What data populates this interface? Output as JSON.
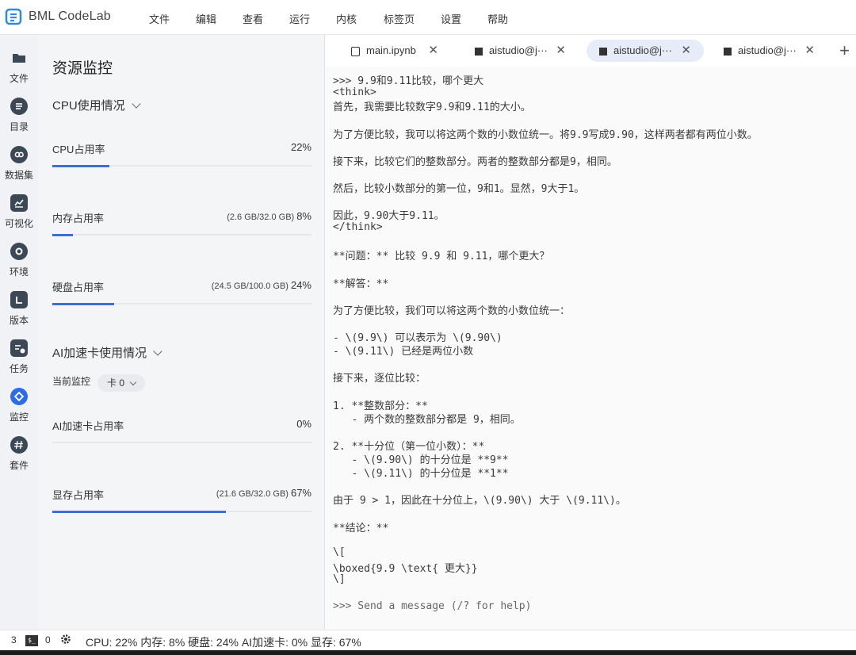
{
  "app": {
    "name": "BML CodeLab"
  },
  "menu": [
    "文件",
    "编辑",
    "查看",
    "运行",
    "内核",
    "标签页",
    "设置",
    "帮助"
  ],
  "sidebar": [
    {
      "label": "文件",
      "icon": "folder-icon"
    },
    {
      "label": "目录",
      "icon": "list-icon"
    },
    {
      "label": "数据集",
      "icon": "dataset-icon"
    },
    {
      "label": "可视化",
      "icon": "chart-icon"
    },
    {
      "label": "环境",
      "icon": "environment-icon"
    },
    {
      "label": "版本",
      "icon": "version-icon"
    },
    {
      "label": "任务",
      "icon": "task-icon"
    },
    {
      "label": "监控",
      "icon": "monitor-icon",
      "active": true
    },
    {
      "label": "套件",
      "icon": "suite-icon"
    }
  ],
  "monitor": {
    "title": "资源监控",
    "cpu_section": "CPU使用情况",
    "ai_section": "AI加速卡使用情况",
    "current_label": "当前监控",
    "card_value": "卡 0",
    "metrics": {
      "cpu": {
        "label": "CPU占用率",
        "detail": "",
        "percent": "22%",
        "fraction": 0.22
      },
      "mem": {
        "label": "内存占用率",
        "detail": "(2.6 GB/32.0 GB)",
        "percent": "8%",
        "fraction": 0.08
      },
      "disk": {
        "label": "硬盘占用率",
        "detail": "(24.5 GB/100.0 GB)",
        "percent": "24%",
        "fraction": 0.24
      },
      "ai": {
        "label": "AI加速卡占用率",
        "detail": "",
        "percent": "0%",
        "fraction": 0
      },
      "vram": {
        "label": "显存占用率",
        "detail": "(21.6 GB/32.0 GB)",
        "percent": "67%",
        "fraction": 0.67
      }
    }
  },
  "tabs": [
    {
      "label": "main.ipynb",
      "active": false
    },
    {
      "label": "aistudio@j···",
      "active": false
    },
    {
      "label": "aistudio@j···",
      "active": true
    },
    {
      "label": "aistudio@j···",
      "active": false
    }
  ],
  "terminal": {
    "lines": [
      ">>> 9.9和9.11比较，哪个更大",
      "<think>",
      "首先，我需要比较数字9.9和9.11的大小。",
      "为了方便比较，我可以将这两个数的小数位统一。将9.9写成9.90，这样两者都有两位小数。",
      "接下来，比较它们的整数部分。两者的整数部分都是9，相同。",
      "然后，比较小数部分的第一位，9和1。显然，9大于1。",
      "因此，9.90大于9.11。",
      "</think>",
      "**问题：** 比较 9.9 和 9.11，哪个更大？",
      "**解答：**",
      "为了方便比较，我们可以将这两个数的小数位统一：",
      "- \\(9.9\\) 可以表示为 \\(9.90\\)",
      "- \\(9.11\\) 已经是两位小数",
      "接下来，逐位比较：",
      "1. **整数部分：**",
      "   - 两个数的整数部分都是 9，相同。",
      "2. **十分位（第一位小数）：**",
      "   - \\(9.90\\) 的十分位是 **9**",
      "   - \\(9.11\\) 的十分位是 **1**",
      "由于 9 > 1，因此在十分位上，\\(9.90\\) 大于 \\(9.11\\)。",
      "**结论：**",
      "\\[",
      "\\boxed{9.9 \\text{ 更大}}",
      "\\]",
      ">>> Send a message (/? for help)"
    ]
  },
  "status": {
    "terminals": "3",
    "terminal_icon": "$_",
    "kernels": "0",
    "text": "CPU: 22% 内存: 8% 硬盘: 24% AI加速卡: 0% 显存: 67%"
  },
  "colors": {
    "accent": "#3a6fd8",
    "active_icon": "#2e6be6",
    "dark_icon": "#3d4856"
  }
}
